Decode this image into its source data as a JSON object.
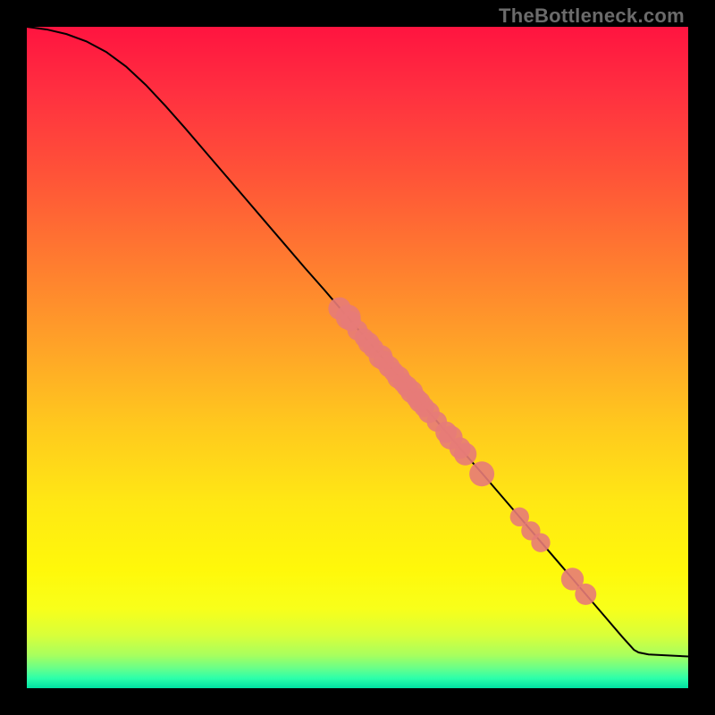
{
  "watermark": "TheBottleneck.com",
  "chart_data": {
    "type": "line",
    "title": "",
    "xlabel": "",
    "ylabel": "",
    "xlim": [
      0,
      100
    ],
    "ylim": [
      0,
      100
    ],
    "grid": false,
    "curve": [
      {
        "x": 0.0,
        "y": 100.0
      },
      {
        "x": 3.0,
        "y": 99.6
      },
      {
        "x": 6.0,
        "y": 98.9
      },
      {
        "x": 9.0,
        "y": 97.8
      },
      {
        "x": 12.0,
        "y": 96.2
      },
      {
        "x": 15.0,
        "y": 94.0
      },
      {
        "x": 18.0,
        "y": 91.2
      },
      {
        "x": 21.0,
        "y": 88.0
      },
      {
        "x": 24.0,
        "y": 84.6
      },
      {
        "x": 27.0,
        "y": 81.1
      },
      {
        "x": 30.0,
        "y": 77.6
      },
      {
        "x": 33.0,
        "y": 74.1
      },
      {
        "x": 36.0,
        "y": 70.6
      },
      {
        "x": 39.0,
        "y": 67.1
      },
      {
        "x": 42.0,
        "y": 63.6
      },
      {
        "x": 45.0,
        "y": 60.2
      },
      {
        "x": 48.0,
        "y": 56.7
      },
      {
        "x": 51.0,
        "y": 53.2
      },
      {
        "x": 54.0,
        "y": 49.7
      },
      {
        "x": 57.0,
        "y": 46.2
      },
      {
        "x": 60.0,
        "y": 42.7
      },
      {
        "x": 63.0,
        "y": 39.2
      },
      {
        "x": 66.0,
        "y": 35.7
      },
      {
        "x": 69.0,
        "y": 32.3
      },
      {
        "x": 72.0,
        "y": 28.8
      },
      {
        "x": 75.0,
        "y": 25.3
      },
      {
        "x": 78.0,
        "y": 21.8
      },
      {
        "x": 81.0,
        "y": 18.3
      },
      {
        "x": 84.0,
        "y": 14.8
      },
      {
        "x": 87.0,
        "y": 11.3
      },
      {
        "x": 90.0,
        "y": 7.8
      },
      {
        "x": 91.8,
        "y": 5.8
      },
      {
        "x": 92.5,
        "y": 5.4
      },
      {
        "x": 94.0,
        "y": 5.1
      },
      {
        "x": 96.0,
        "y": 5.0
      },
      {
        "x": 98.0,
        "y": 4.9
      },
      {
        "x": 100.0,
        "y": 4.8
      }
    ],
    "scatter": [
      {
        "x": 47.3,
        "y": 57.4,
        "r": 1.3
      },
      {
        "x": 48.6,
        "y": 56.1,
        "r": 1.5
      },
      {
        "x": 49.0,
        "y": 55.5,
        "r": 1.1
      },
      {
        "x": 50.0,
        "y": 54.1,
        "r": 1.1
      },
      {
        "x": 51.0,
        "y": 53.0,
        "r": 1.0
      },
      {
        "x": 51.7,
        "y": 52.2,
        "r": 1.2
      },
      {
        "x": 52.4,
        "y": 51.4,
        "r": 1.1
      },
      {
        "x": 53.5,
        "y": 50.1,
        "r": 1.4
      },
      {
        "x": 54.0,
        "y": 49.5,
        "r": 1.1
      },
      {
        "x": 54.8,
        "y": 48.6,
        "r": 1.2
      },
      {
        "x": 55.5,
        "y": 47.8,
        "r": 1.1
      },
      {
        "x": 56.2,
        "y": 47.0,
        "r": 1.3
      },
      {
        "x": 56.9,
        "y": 46.2,
        "r": 1.1
      },
      {
        "x": 57.5,
        "y": 45.6,
        "r": 1.2
      },
      {
        "x": 58.2,
        "y": 44.8,
        "r": 1.3
      },
      {
        "x": 58.9,
        "y": 43.9,
        "r": 1.1
      },
      {
        "x": 59.4,
        "y": 43.3,
        "r": 1.2
      },
      {
        "x": 60.1,
        "y": 42.5,
        "r": 1.1
      },
      {
        "x": 60.8,
        "y": 41.7,
        "r": 1.2
      },
      {
        "x": 62.0,
        "y": 40.3,
        "r": 1.1
      },
      {
        "x": 63.4,
        "y": 38.7,
        "r": 1.2
      },
      {
        "x": 64.1,
        "y": 37.9,
        "r": 1.4
      },
      {
        "x": 65.5,
        "y": 36.3,
        "r": 1.2
      },
      {
        "x": 66.3,
        "y": 35.4,
        "r": 1.3
      },
      {
        "x": 68.8,
        "y": 32.4,
        "r": 1.5
      },
      {
        "x": 74.5,
        "y": 25.9,
        "r": 1.0
      },
      {
        "x": 76.2,
        "y": 23.8,
        "r": 1.0
      },
      {
        "x": 77.7,
        "y": 22.0,
        "r": 1.0
      },
      {
        "x": 82.5,
        "y": 16.5,
        "r": 1.3
      },
      {
        "x": 84.5,
        "y": 14.2,
        "r": 1.2
      }
    ],
    "gradient_stops": [
      {
        "offset": 0.0,
        "color": "#ff1440"
      },
      {
        "offset": 0.1,
        "color": "#ff3040"
      },
      {
        "offset": 0.22,
        "color": "#ff5238"
      },
      {
        "offset": 0.35,
        "color": "#ff7a30"
      },
      {
        "offset": 0.48,
        "color": "#ffa228"
      },
      {
        "offset": 0.6,
        "color": "#ffc81e"
      },
      {
        "offset": 0.72,
        "color": "#ffe814"
      },
      {
        "offset": 0.82,
        "color": "#fff80a"
      },
      {
        "offset": 0.88,
        "color": "#f8ff1a"
      },
      {
        "offset": 0.92,
        "color": "#d8ff3a"
      },
      {
        "offset": 0.95,
        "color": "#a8ff5e"
      },
      {
        "offset": 0.97,
        "color": "#68ff8a"
      },
      {
        "offset": 0.985,
        "color": "#2cffaa"
      },
      {
        "offset": 1.0,
        "color": "#00e0a2"
      }
    ],
    "scatter_color": "#e77b78",
    "line_color": "#000000"
  }
}
